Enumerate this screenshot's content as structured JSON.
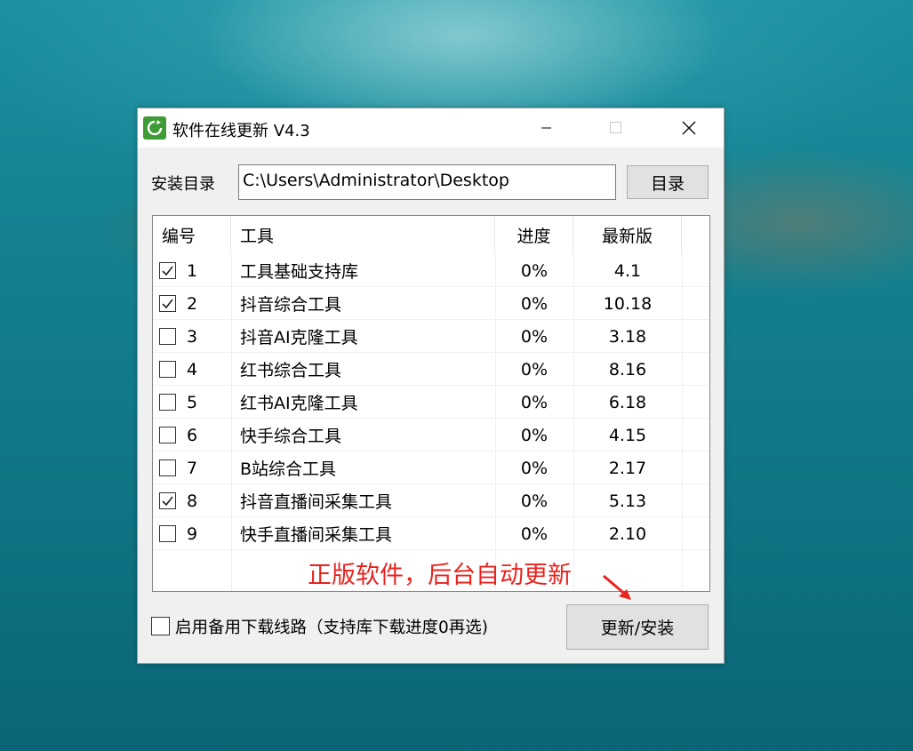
{
  "window": {
    "title": "软件在线更新 V4.3",
    "controls": {
      "minimize": "minimize",
      "maximize": "maximize",
      "close": "close"
    }
  },
  "install_dir": {
    "label": "安装目录",
    "value": "C:\\Users\\Administrator\\Desktop",
    "browse_label": "目录"
  },
  "table": {
    "columns": [
      "编号",
      "工具",
      "进度",
      "最新版"
    ],
    "rows": [
      {
        "checked": true,
        "id": "1",
        "tool": "工具基础支持库",
        "progress": "0%",
        "version": "4.1"
      },
      {
        "checked": true,
        "id": "2",
        "tool": "抖音综合工具",
        "progress": "0%",
        "version": "10.18"
      },
      {
        "checked": false,
        "id": "3",
        "tool": "抖音AI克隆工具",
        "progress": "0%",
        "version": "3.18"
      },
      {
        "checked": false,
        "id": "4",
        "tool": "红书综合工具",
        "progress": "0%",
        "version": "8.16"
      },
      {
        "checked": false,
        "id": "5",
        "tool": "红书AI克隆工具",
        "progress": "0%",
        "version": "6.18"
      },
      {
        "checked": false,
        "id": "6",
        "tool": "快手综合工具",
        "progress": "0%",
        "version": "4.15"
      },
      {
        "checked": false,
        "id": "7",
        "tool": "B站综合工具",
        "progress": "0%",
        "version": "2.17"
      },
      {
        "checked": true,
        "id": "8",
        "tool": "抖音直播间采集工具",
        "progress": "0%",
        "version": "5.13"
      },
      {
        "checked": false,
        "id": "9",
        "tool": "快手直播间采集工具",
        "progress": "0%",
        "version": "2.10"
      }
    ]
  },
  "backup_route": {
    "checked": false,
    "label": "启用备用下载线路（支持库下载进度0再选)"
  },
  "update_button": "更新/安装",
  "annotation": {
    "text": "正版软件，后台自动更新",
    "color": "#e8231f"
  },
  "colors": {
    "app_icon": "#3f9b36",
    "desktop": "#13808f"
  }
}
